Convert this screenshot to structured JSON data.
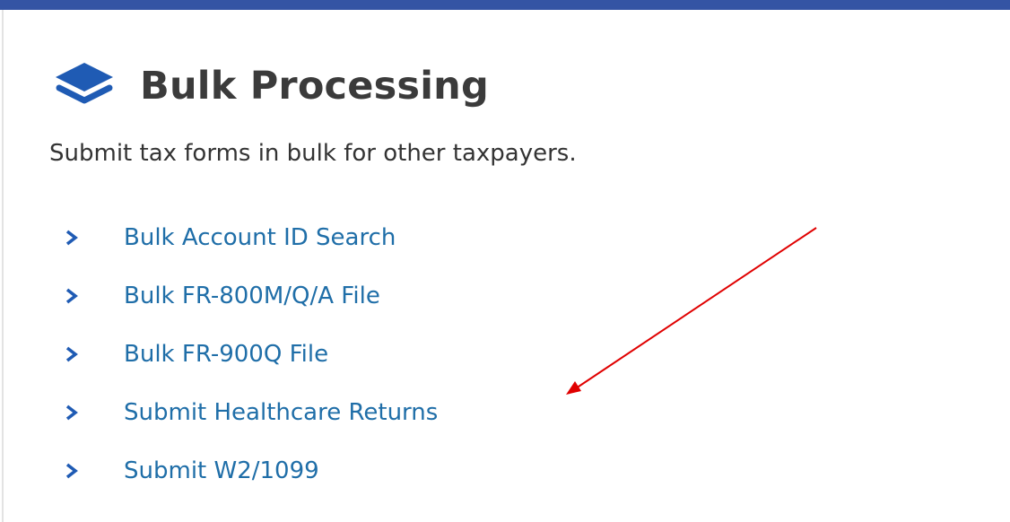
{
  "header": {
    "icon": "layers-icon",
    "title": "Bulk Processing"
  },
  "subtitle": "Submit tax forms in bulk for other taxpayers.",
  "links": [
    {
      "label": "Bulk Account ID Search",
      "icon": "chevron-right-icon"
    },
    {
      "label": "Bulk FR-800M/Q/A File",
      "icon": "chevron-right-icon"
    },
    {
      "label": "Bulk FR-900Q File",
      "icon": "chevron-right-icon"
    },
    {
      "label": "Submit Healthcare Returns",
      "icon": "chevron-right-icon"
    },
    {
      "label": "Submit W2/1099",
      "icon": "chevron-right-icon"
    }
  ],
  "colors": {
    "top_bar": "#3454a4",
    "link": "#1f6ea8",
    "icon": "#1f5bb4",
    "annotation_arrow": "#e00000"
  }
}
